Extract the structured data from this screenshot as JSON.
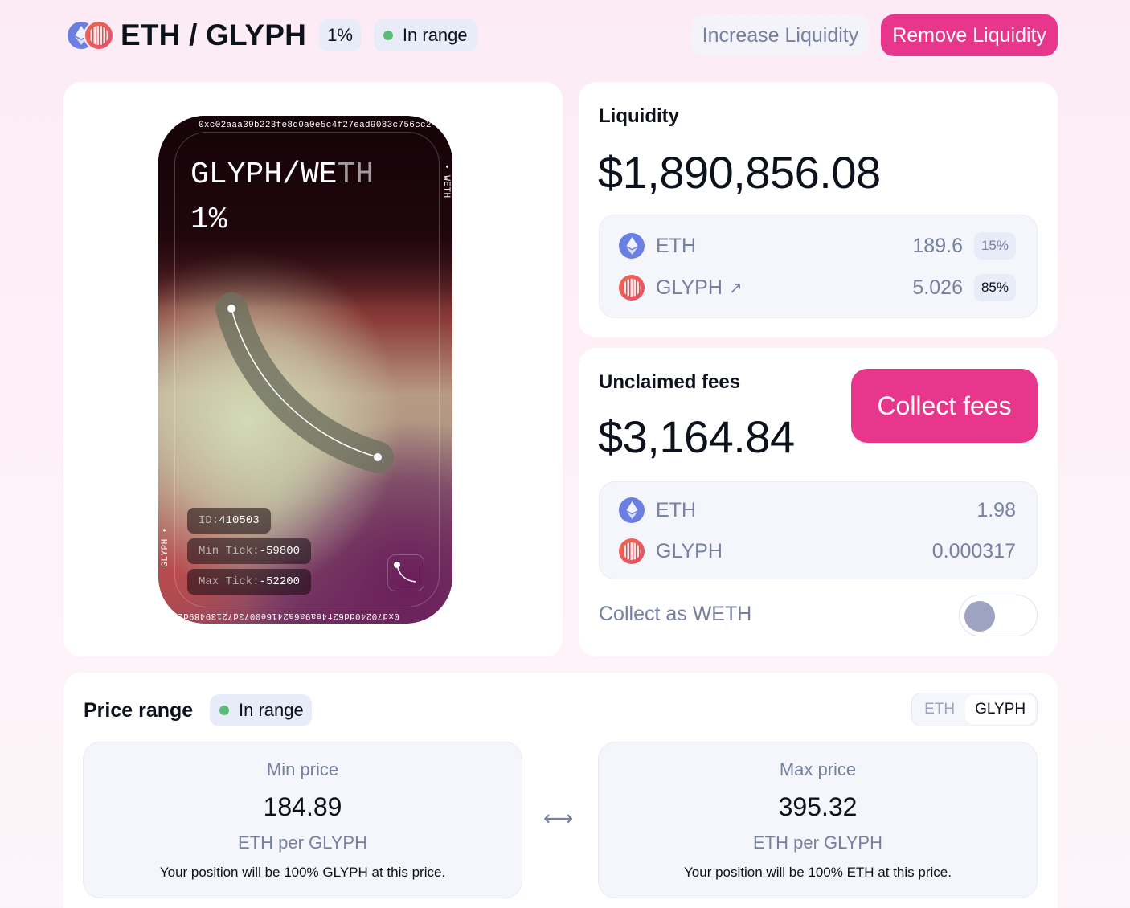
{
  "header": {
    "pair_title": "ETH / GLYPH",
    "fee_tier": "1%",
    "status": "In range",
    "status_color": "#5dbb78",
    "increase_label": "Increase Liquidity",
    "remove_label": "Remove Liquidity",
    "token0_icon": "eth-icon",
    "token1_icon": "glyph-icon"
  },
  "nft": {
    "address_top": "0xc02aaa39b223fe8d0a0e5c4f27ead9083c756cc2",
    "side_right": "• WETH",
    "side_left": "GLYPH •",
    "address_bottom": "0xd70240dd62f4ea9a6a2416e0073d72139489d2aa",
    "pair": "GLYPH/WE",
    "pair_fade": "TH",
    "fee": "1%",
    "id_key": "ID: ",
    "id_value": "410503",
    "min_tick_key": "Min Tick: ",
    "min_tick_value": "-59800",
    "max_tick_key": "Max Tick: ",
    "max_tick_value": "-52200"
  },
  "liquidity": {
    "title": "Liquidity",
    "value": "$1,890,856.08",
    "tokens": [
      {
        "symbol": "ETH",
        "amount": "189.6",
        "share": "15%"
      },
      {
        "symbol": "GLYPH",
        "amount": "5.026",
        "share": "85%",
        "external_link_icon": "arrow-up-right-icon"
      }
    ]
  },
  "fees": {
    "title": "Unclaimed fees",
    "value": "$3,164.84",
    "collect_label": "Collect fees",
    "tokens": [
      {
        "symbol": "ETH",
        "amount": "1.98"
      },
      {
        "symbol": "GLYPH",
        "amount": "0.000317"
      }
    ],
    "collect_as_weth_label": "Collect as WETH",
    "collect_as_weth_on": false
  },
  "price_range": {
    "title": "Price range",
    "status": "In range",
    "toggle_options": [
      "ETH",
      "GLYPH"
    ],
    "toggle_selected": "GLYPH",
    "min": {
      "label": "Min price",
      "value": "184.89",
      "unit": "ETH per GLYPH",
      "note": "Your position will be 100% GLYPH at this price."
    },
    "max": {
      "label": "Max price",
      "value": "395.32",
      "unit": "ETH per GLYPH",
      "note": "Your position will be 100% ETH at this price."
    },
    "arrow": "⟷"
  },
  "colors": {
    "accent": "#e8368d",
    "eth": "#6b7fe3",
    "glyph": "#e84c6a",
    "muted_text": "#7780a0"
  }
}
